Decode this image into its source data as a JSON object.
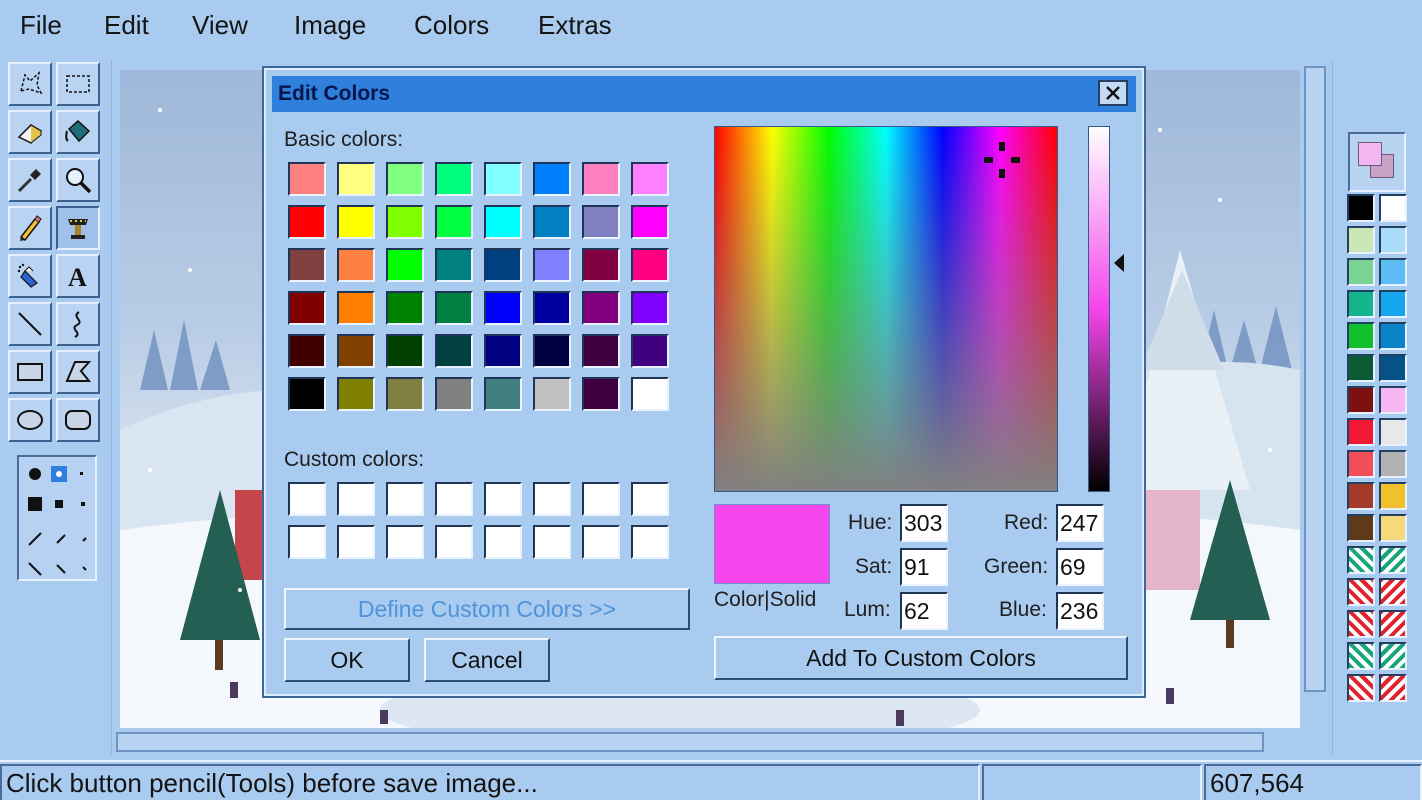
{
  "menu": [
    "File",
    "Edit",
    "View",
    "Image",
    "Colors",
    "Extras"
  ],
  "status": {
    "message": "Click button pencil(Tools) before save image...",
    "middle": "",
    "coords": "607,564"
  },
  "dialog": {
    "title": "Edit Colors",
    "basic_label": "Basic colors:",
    "custom_label": "Custom colors:",
    "define_button": "Define Custom Colors >>",
    "ok_button": "OK",
    "cancel_button": "Cancel",
    "add_button": "Add To Custom Colors",
    "preview_label": "Color|Solid",
    "preview_color": "#f545ec",
    "hue_label": "Hue:",
    "hue": "303",
    "sat_label": "Sat:",
    "sat": "91",
    "lum_label": "Lum:",
    "lum": "62",
    "red_label": "Red:",
    "red": "247",
    "green_label": "Green:",
    "green": "69",
    "blue_label": "Blue:",
    "blue": "236",
    "basic_colors": [
      [
        "#ff8080",
        "#ffff80",
        "#80ff80",
        "#00ff80",
        "#80ffff",
        "#0080ff",
        "#ff80c0",
        "#ff80ff"
      ],
      [
        "#ff0000",
        "#ffff00",
        "#80ff00",
        "#00ff40",
        "#00ffff",
        "#0080c0",
        "#8080c0",
        "#ff00ff"
      ],
      [
        "#804040",
        "#ff8040",
        "#00ff00",
        "#008080",
        "#004080",
        "#8080ff",
        "#800040",
        "#ff0080"
      ],
      [
        "#800000",
        "#ff8000",
        "#008000",
        "#008040",
        "#0000ff",
        "#0000a0",
        "#800080",
        "#8000ff"
      ],
      [
        "#400000",
        "#804000",
        "#004000",
        "#004040",
        "#000080",
        "#000040",
        "#400040",
        "#400080"
      ],
      [
        "#000000",
        "#808000",
        "#808040",
        "#808080",
        "#408080",
        "#c0c0c0",
        "#400040",
        "#ffffff"
      ]
    ],
    "custom_colors": [
      [
        "#ffffff",
        "#ffffff",
        "#ffffff",
        "#ffffff",
        "#ffffff",
        "#ffffff",
        "#ffffff",
        "#ffffff"
      ],
      [
        "#ffffff",
        "#ffffff",
        "#ffffff",
        "#ffffff",
        "#ffffff",
        "#ffffff",
        "#ffffff",
        "#ffffff"
      ]
    ]
  },
  "palette": {
    "primary": "#f2b6f0",
    "secondary": "#c9a3c5",
    "colors": [
      [
        "#000000",
        "#ffffff"
      ],
      [
        "#c9e6b4",
        "#a9dcfb"
      ],
      [
        "#79d392",
        "#5ebcf5"
      ],
      [
        "#14b48d",
        "#16a6ee"
      ],
      [
        "#0fbf2b",
        "#0a83c8"
      ],
      [
        "#0a5a34",
        "#055287"
      ],
      [
        "#7d1010",
        "#f6b6f2"
      ],
      [
        "#f01833",
        "#e8e8e8"
      ],
      [
        "#f24e57",
        "#b2b2b2"
      ],
      [
        "#a43a28",
        "#f0c129"
      ],
      [
        "#5e3a18",
        "#f5d97a"
      ]
    ],
    "pattern_count": 5
  },
  "tools": [
    "free-select-icon",
    "rect-select-icon",
    "eraser-icon",
    "fill-icon",
    "color-picker-icon",
    "magnifier-icon",
    "pencil-icon",
    "brush-icon",
    "airbrush-icon",
    "text-icon",
    "line-icon",
    "curve-icon",
    "rectangle-icon",
    "polygon-icon",
    "ellipse-icon",
    "rounded-rect-icon"
  ]
}
